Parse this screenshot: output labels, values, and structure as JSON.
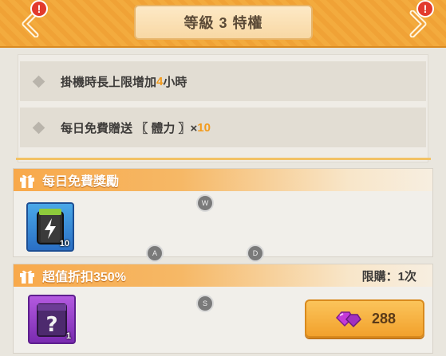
{
  "header": {
    "title": "等級 3 特權",
    "prev_alert": "!",
    "next_alert": "!"
  },
  "privileges": [
    {
      "prefix": "掛機時長上限增加",
      "highlight": "4",
      "suffix": "小時"
    },
    {
      "prefix": "每日免費贈送",
      "item": "〖 體力 〗×",
      "highlight": "10"
    }
  ],
  "daily_reward": {
    "title": "每日免費獎勵",
    "item": {
      "icon": "energy-battery-icon",
      "quantity": "10"
    }
  },
  "discount_offer": {
    "title": "超值折扣350%",
    "limit_label": "限購：1次",
    "item": {
      "icon": "mystery-box-icon",
      "quantity": "1"
    },
    "price": "288",
    "price_icon": "gem-icon"
  },
  "key_hints": {
    "w": "W",
    "a": "A",
    "s": "S",
    "d": "D"
  },
  "colors": {
    "accent": "#f39b1c",
    "header": "#f3ab3e",
    "button": "#f5b03e"
  }
}
